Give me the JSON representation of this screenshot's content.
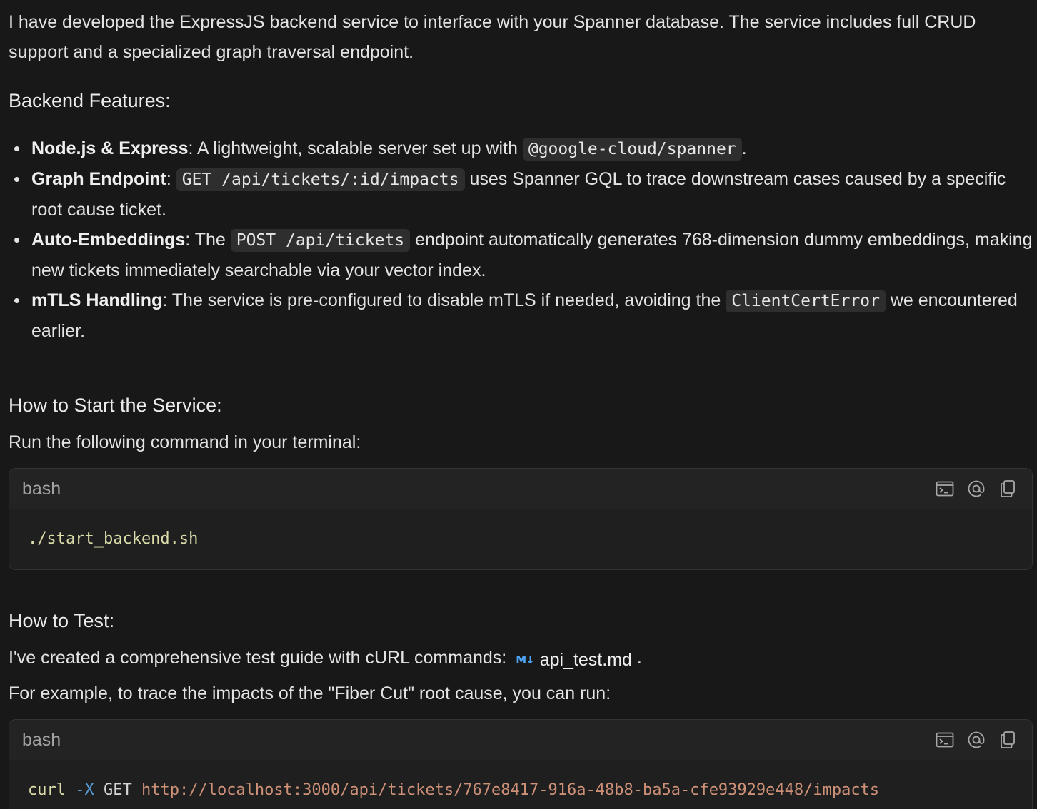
{
  "intro": "I have developed the ExpressJS backend service to interface with your Spanner database. The service includes full CRUD support and a specialized graph traversal endpoint.",
  "features_heading": "Backend Features:",
  "features": [
    {
      "title": "Node.js & Express",
      "text_before": ": A lightweight, scalable server set up with ",
      "code": "@google-cloud/spanner",
      "text_after": "."
    },
    {
      "title": "Graph Endpoint",
      "text_before": ": ",
      "code": "GET /api/tickets/:id/impacts",
      "text_after": " uses Spanner GQL to trace downstream cases caused by a specific root cause ticket."
    },
    {
      "title": "Auto-Embeddings",
      "text_before": ": The ",
      "code": "POST /api/tickets",
      "text_after": " endpoint automatically generates 768-dimension dummy embeddings, making new tickets immediately searchable via your vector index."
    },
    {
      "title": "mTLS Handling",
      "text_before": ": The service is pre-configured to disable mTLS if needed, avoiding the ",
      "code": "ClientCertError",
      "text_after": " we encountered earlier."
    }
  ],
  "start_heading": "How to Start the Service:",
  "start_text": "Run the following command in your terminal:",
  "code_block_1": {
    "lang": "bash",
    "command": "./start_backend.sh"
  },
  "test_heading": "How to Test:",
  "test_text": "I've created a comprehensive test guide with cURL commands:",
  "test_file_icon": "M↓",
  "test_file": "api_test.md",
  "test_text_after": " .",
  "example_text": "For example, to trace the impacts of the \"Fiber Cut\" root cause, you can run:",
  "code_block_2": {
    "lang": "bash",
    "cmd": "curl",
    "flag": "-X",
    "method": "GET",
    "url": "http://localhost:3000/api/tickets/767e8417-916a-48b8-ba5a-cfe93929e448/impacts"
  },
  "icons": {
    "terminal": "terminal-icon",
    "mention": "at-sign-icon",
    "copy": "copy-icon",
    "markdown": "markdown-file-icon"
  },
  "colors": {
    "background": "#181818",
    "text": "#e3e3e3",
    "inline_code_bg": "#2e2e2e",
    "code_cmd": "#dcdcaa",
    "code_flag": "#569cd6",
    "code_url": "#ce9178",
    "md_icon": "#4fa3f7"
  }
}
